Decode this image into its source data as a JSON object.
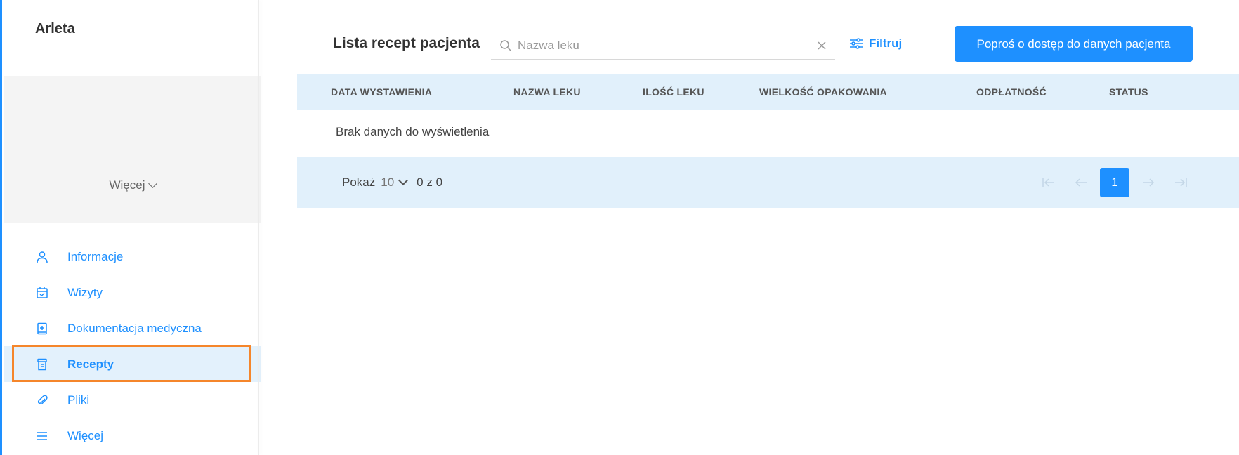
{
  "patient": {
    "name": "Arleta"
  },
  "sidebar": {
    "more_toggle_label": "Więcej",
    "items": [
      {
        "label": "Informacje",
        "icon": "user-icon"
      },
      {
        "label": "Wizyty",
        "icon": "calendar-check-icon"
      },
      {
        "label": "Dokumentacja medyczna",
        "icon": "medical-book-icon"
      },
      {
        "label": "Recepty",
        "icon": "prescription-icon",
        "active": true
      },
      {
        "label": "Pliki",
        "icon": "paperclip-icon"
      },
      {
        "label": "Więcej",
        "icon": "menu-icon"
      }
    ]
  },
  "main": {
    "title": "Lista recept pacjenta",
    "search": {
      "placeholder": "Nazwa leku",
      "value": ""
    },
    "filter_label": "Filtruj",
    "request_access_label": "Poproś o dostęp do danych pacjenta",
    "table": {
      "columns": [
        "DATA WYSTAWIENIA",
        "NAZWA LEKU",
        "ILOŚĆ LEKU",
        "WIELKOŚĆ OPAKOWANIA",
        "ODPŁATNOŚĆ",
        "STATUS"
      ],
      "empty_message": "Brak danych do wyświetlenia"
    },
    "pagination": {
      "show_label": "Pokaż",
      "page_size": "10",
      "range_label": "0 z 0",
      "current_page": "1"
    }
  },
  "colors": {
    "accent": "#1e90ff",
    "table_header_bg": "#e1f0fb",
    "active_nav_bg": "#e3f1fc",
    "highlight_border": "#f5862b"
  }
}
